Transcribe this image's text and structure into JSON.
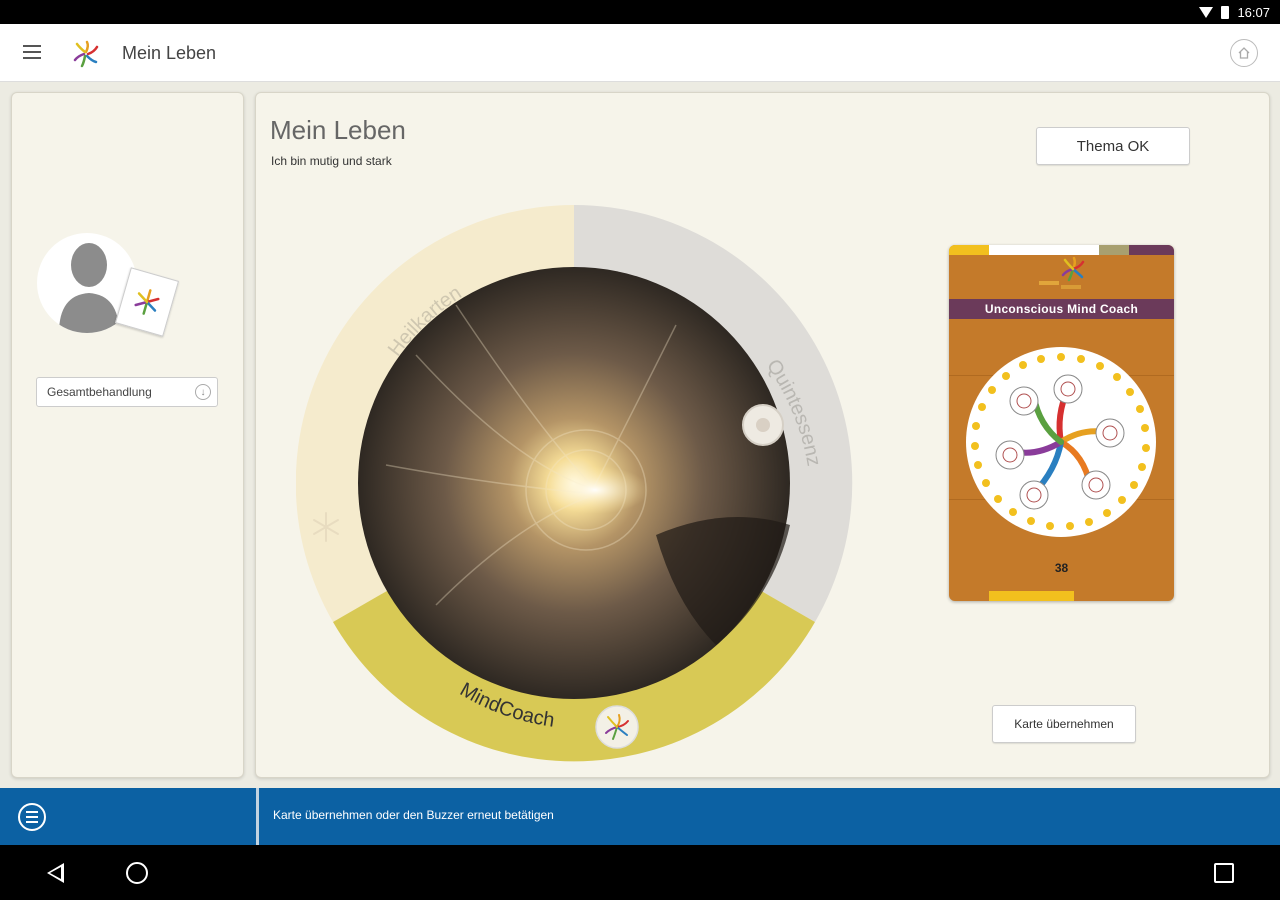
{
  "statusbar": {
    "time": "16:07"
  },
  "appbar": {
    "title": "Mein Leben"
  },
  "left_panel": {
    "dropdown_value": "Gesamtbehandlung"
  },
  "main": {
    "title": "Mein Leben",
    "subtitle": "Ich bin mutig und stark",
    "thema_button": "Thema OK",
    "karte_button": "Karte übernehmen"
  },
  "wheel": {
    "segments": [
      {
        "label": "Heilkarten",
        "color": "#f5ebcd"
      },
      {
        "label": "Quintessenz",
        "color": "#dedcd8"
      },
      {
        "label": "MindCoach",
        "color": "#d8c955"
      }
    ]
  },
  "card": {
    "title": "Unconscious Mind Coach",
    "number": "38"
  },
  "infobar": {
    "message": "Karte übernehmen oder den Buzzer erneut betätigen"
  },
  "colors": {
    "accent_blue": "#0c61a3",
    "card_orange": "#c47a2a",
    "card_purple": "#6b3a5a",
    "panel_bg": "#f6f4ea"
  }
}
